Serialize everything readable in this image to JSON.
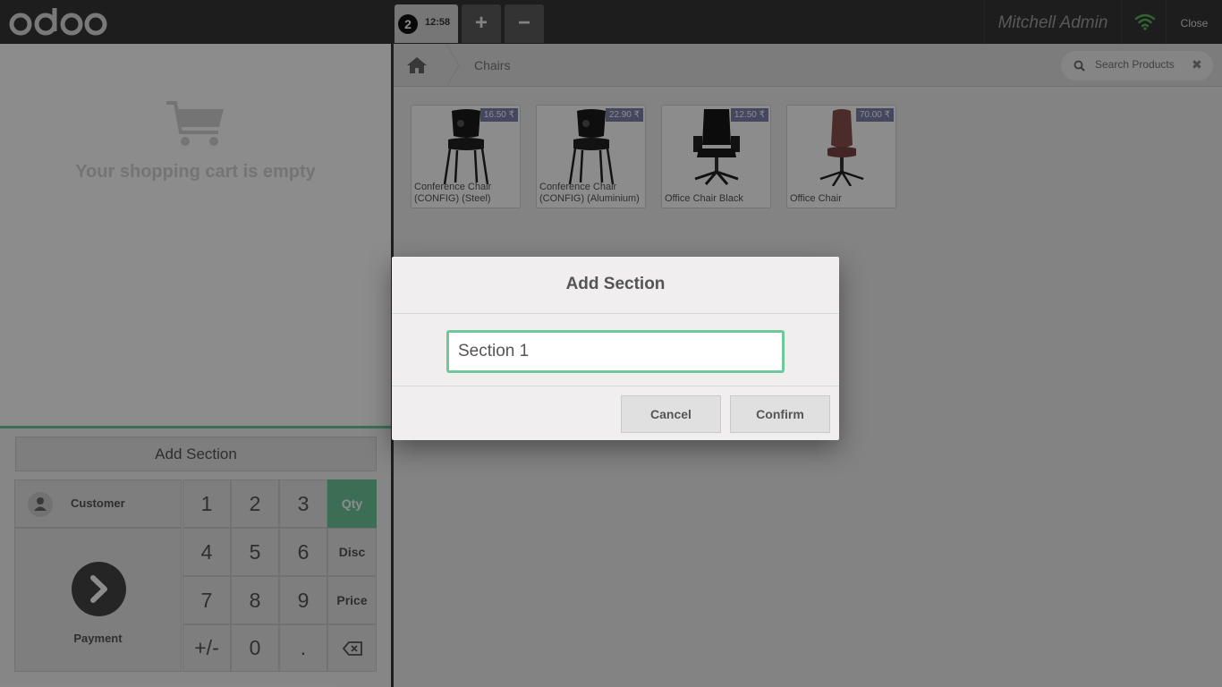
{
  "header": {
    "logo_text": "odoo",
    "order_number": "2",
    "order_time": "12:58",
    "add_order_symbol": "+",
    "remove_order_symbol": "−",
    "user_name": "Mitchell Admin",
    "close_label": "Close",
    "wifi_color": "#5cb85c"
  },
  "cart": {
    "empty_message": "Your shopping cart is empty"
  },
  "controls": {
    "add_section_label": "Add Section",
    "customer_label": "Customer",
    "payment_label": "Payment",
    "accent_color": "#6ec89b",
    "numpad": {
      "k1": "1",
      "k2": "2",
      "k3": "3",
      "qty": "Qty",
      "k4": "4",
      "k5": "5",
      "k6": "6",
      "disc": "Disc",
      "k7": "7",
      "k8": "8",
      "k9": "9",
      "price": "Price",
      "plusminus": "+/-",
      "k0": "0",
      "dot": ".",
      "backspace_icon": "backspace-icon"
    }
  },
  "products_pane": {
    "breadcrumb": "Chairs",
    "search_placeholder": "Search Products",
    "search_clear": "✖",
    "products": [
      {
        "name": "Conference Chair (CONFIG) (Steel)",
        "price": "16.50 ₹"
      },
      {
        "name": "Conference Chair (CONFIG) (Aluminium)",
        "price": "22.90 ₹"
      },
      {
        "name": "Office Chair Black",
        "price": "12.50 ₹"
      },
      {
        "name": "Office Chair",
        "price": "70.00 ₹"
      }
    ]
  },
  "dialog": {
    "title": "Add Section",
    "input_value": "Section 1",
    "cancel_label": "Cancel",
    "confirm_label": "Confirm"
  }
}
